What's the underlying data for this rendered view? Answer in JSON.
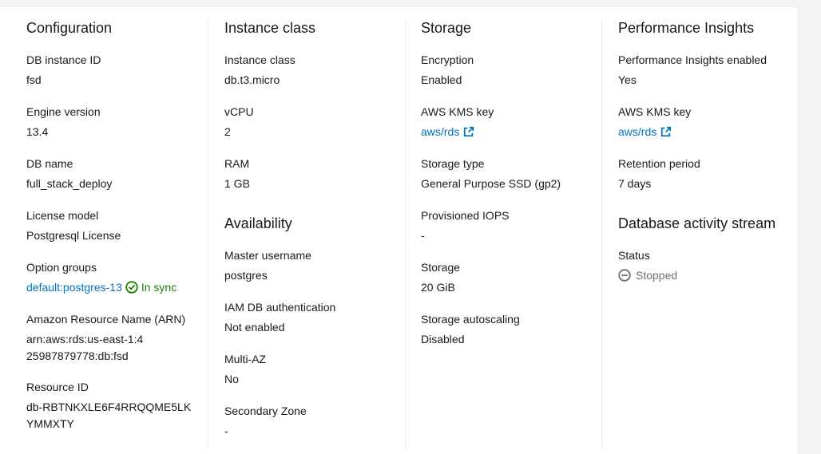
{
  "configuration": {
    "title": "Configuration",
    "db_instance_id_label": "DB instance ID",
    "db_instance_id": "fsd",
    "engine_version_label": "Engine version",
    "engine_version": "13.4",
    "db_name_label": "DB name",
    "db_name": "full_stack_deploy",
    "license_model_label": "License model",
    "license_model": "Postgresql License",
    "option_groups_label": "Option groups",
    "option_group_link": "default:postgres-13",
    "option_group_status": "In sync",
    "arn_label": "Amazon Resource Name (ARN)",
    "arn": "arn:aws:rds:us-east-1:425987879778:db:fsd",
    "resource_id_label": "Resource ID",
    "resource_id": "db-RBTNKXLE6F4RRQQME5LKYMMXTY"
  },
  "instance_class": {
    "title": "Instance class",
    "instance_class_label": "Instance class",
    "instance_class": "db.t3.micro",
    "vcpu_label": "vCPU",
    "vcpu": "2",
    "ram_label": "RAM",
    "ram": "1 GB"
  },
  "availability": {
    "title": "Availability",
    "master_username_label": "Master username",
    "master_username": "postgres",
    "iam_auth_label": "IAM DB authentication",
    "iam_auth": "Not enabled",
    "multi_az_label": "Multi-AZ",
    "multi_az": "No",
    "secondary_zone_label": "Secondary Zone",
    "secondary_zone": "-"
  },
  "storage": {
    "title": "Storage",
    "encryption_label": "Encryption",
    "encryption": "Enabled",
    "kms_key_label": "AWS KMS key",
    "kms_key_link": "aws/rds",
    "storage_type_label": "Storage type",
    "storage_type": "General Purpose SSD (gp2)",
    "provisioned_iops_label": "Provisioned IOPS",
    "provisioned_iops": "-",
    "storage_label": "Storage",
    "storage": "20 GiB",
    "autoscaling_label": "Storage autoscaling",
    "autoscaling": "Disabled"
  },
  "performance_insights": {
    "title": "Performance Insights",
    "enabled_label": "Performance Insights enabled",
    "enabled": "Yes",
    "kms_key_label": "AWS KMS key",
    "kms_key_link": "aws/rds",
    "retention_label": "Retention period",
    "retention": "7 days"
  },
  "activity_stream": {
    "title": "Database activity stream",
    "status_label": "Status",
    "status": "Stopped"
  },
  "colors": {
    "link": "#0073bb",
    "success": "#1d8102",
    "muted": "#687078"
  }
}
